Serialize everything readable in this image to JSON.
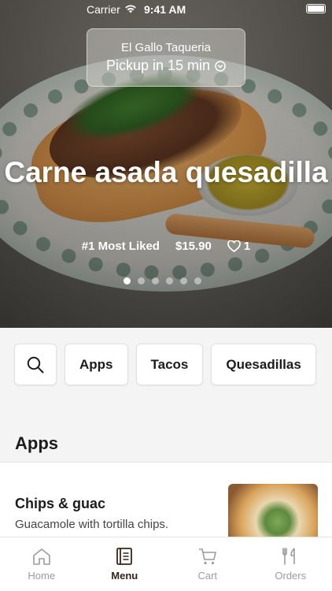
{
  "status_bar": {
    "carrier": "Carrier",
    "time": "9:41 AM"
  },
  "restaurant": {
    "name": "El Gallo Taqueria",
    "pickup": "Pickup in 15 min"
  },
  "featured": {
    "title": "Carne asada quesadilla",
    "rank": "#1 Most Liked",
    "price": "$15.90",
    "likes": "1",
    "carousel_count": 6,
    "carousel_active": 0
  },
  "categories": [
    "Apps",
    "Tacos",
    "Quesadillas"
  ],
  "section": {
    "title": "Apps"
  },
  "items": [
    {
      "name": "Chips & guac",
      "description": "Guacamole with tortilla chips."
    }
  ],
  "tabs": [
    {
      "label": "Home",
      "icon": "home-icon"
    },
    {
      "label": "Menu",
      "icon": "menu-icon",
      "active": true
    },
    {
      "label": "Cart",
      "icon": "cart-icon"
    },
    {
      "label": "Orders",
      "icon": "orders-icon"
    }
  ],
  "colors": {
    "active_tab": "#3a2418",
    "inactive_tab": "#9b9b9b"
  }
}
